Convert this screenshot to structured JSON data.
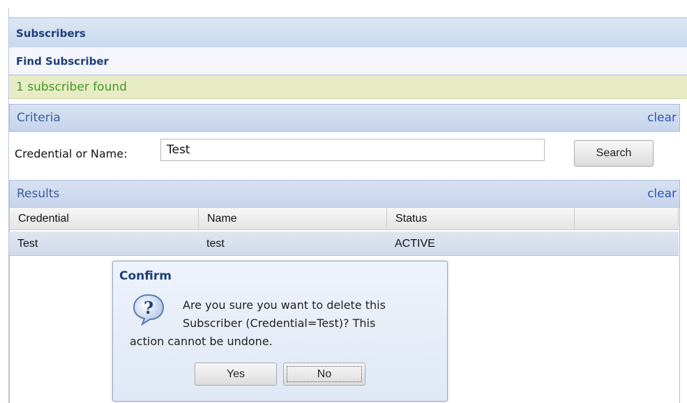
{
  "header": {
    "title": "Subscribers",
    "subtitle": "Find Subscriber",
    "status_message": "1 subscriber found"
  },
  "criteria": {
    "section_title": "Criteria",
    "clear_label": "clear",
    "field_label": "Credential or Name:",
    "field_value": "Test",
    "search_label": "Search"
  },
  "results": {
    "section_title": "Results",
    "clear_label": "clear",
    "columns": [
      "Credential",
      "Name",
      "Status",
      ""
    ],
    "rows": [
      {
        "credential": "Test",
        "name": "test",
        "status": "ACTIVE"
      }
    ]
  },
  "dialog": {
    "title": "Confirm",
    "icon": "question-icon",
    "message_line1": "Are you sure you want to delete this",
    "message_line2": "Subscriber (Credential=Test)? This",
    "message_line3": "action cannot be undone.",
    "yes_label": "Yes",
    "no_label": "No"
  },
  "colors": {
    "header_text": "#1d3f7a",
    "status_green": "#3e9a1e",
    "link_blue": "#2a56b8",
    "section_bg": "#c6d4ec",
    "status_bg": "#e8ecc6"
  }
}
